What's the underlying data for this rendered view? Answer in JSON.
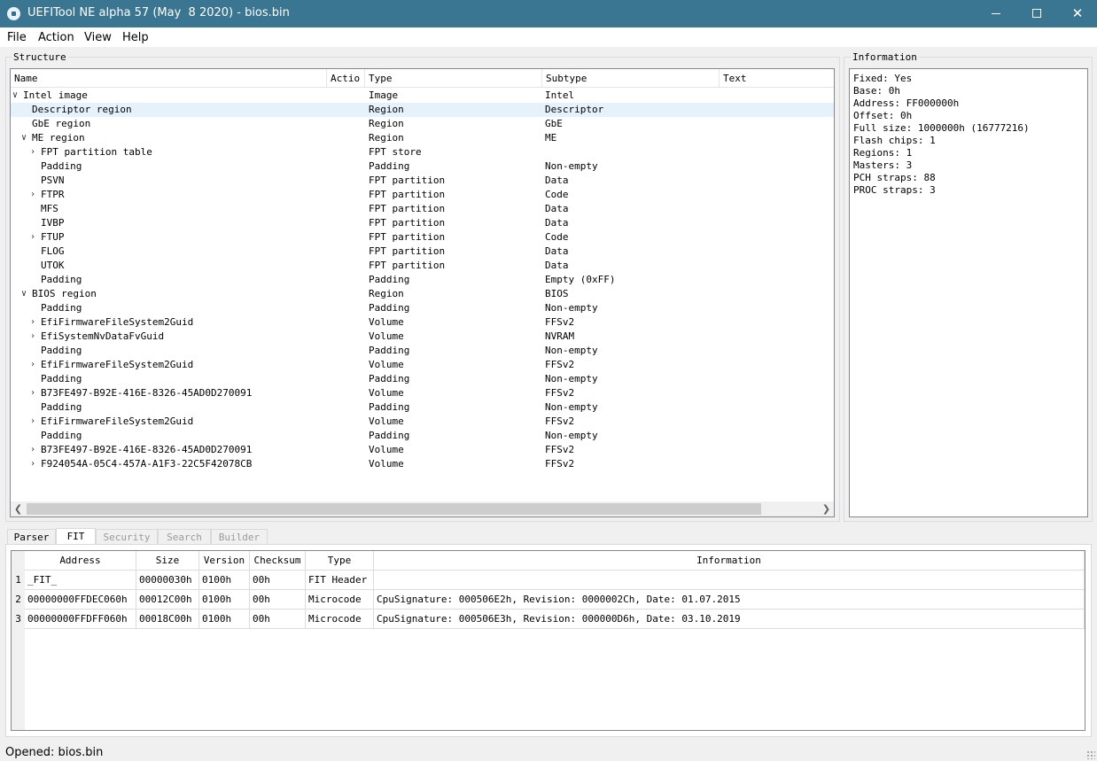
{
  "window": {
    "title": "UEFITool NE alpha 57 (May  8 2020) - bios.bin"
  },
  "menu": [
    "File",
    "Action",
    "View",
    "Help"
  ],
  "structure": {
    "group_title": "Structure",
    "columns": [
      "Name",
      "Actio",
      "Type",
      "Subtype",
      "Text"
    ],
    "rows": [
      {
        "name": "Intel image",
        "type": "Image",
        "subtype": "Intel",
        "level": 0,
        "arrow": "expanded"
      },
      {
        "name": "Descriptor region",
        "type": "Region",
        "subtype": "Descriptor",
        "level": 1,
        "arrow": "none",
        "selected": true
      },
      {
        "name": "GbE region",
        "type": "Region",
        "subtype": "GbE",
        "level": 1,
        "arrow": "none"
      },
      {
        "name": "ME region",
        "type": "Region",
        "subtype": "ME",
        "level": 1,
        "arrow": "expanded"
      },
      {
        "name": "FPT partition table",
        "type": "FPT store",
        "subtype": "",
        "level": 2,
        "arrow": "collapsed"
      },
      {
        "name": "Padding",
        "type": "Padding",
        "subtype": "Non-empty",
        "level": 2,
        "arrow": "none"
      },
      {
        "name": "PSVN",
        "type": "FPT partition",
        "subtype": "Data",
        "level": 2,
        "arrow": "none"
      },
      {
        "name": "FTPR",
        "type": "FPT partition",
        "subtype": "Code",
        "level": 2,
        "arrow": "collapsed"
      },
      {
        "name": "MFS",
        "type": "FPT partition",
        "subtype": "Data",
        "level": 2,
        "arrow": "none"
      },
      {
        "name": "IVBP",
        "type": "FPT partition",
        "subtype": "Data",
        "level": 2,
        "arrow": "none"
      },
      {
        "name": "FTUP",
        "type": "FPT partition",
        "subtype": "Code",
        "level": 2,
        "arrow": "collapsed"
      },
      {
        "name": "FLOG",
        "type": "FPT partition",
        "subtype": "Data",
        "level": 2,
        "arrow": "none"
      },
      {
        "name": "UTOK",
        "type": "FPT partition",
        "subtype": "Data",
        "level": 2,
        "arrow": "none"
      },
      {
        "name": "Padding",
        "type": "Padding",
        "subtype": "Empty (0xFF)",
        "level": 2,
        "arrow": "none"
      },
      {
        "name": "BIOS region",
        "type": "Region",
        "subtype": "BIOS",
        "level": 1,
        "arrow": "expanded"
      },
      {
        "name": "Padding",
        "type": "Padding",
        "subtype": "Non-empty",
        "level": 2,
        "arrow": "none"
      },
      {
        "name": "EfiFirmwareFileSystem2Guid",
        "type": "Volume",
        "subtype": "FFSv2",
        "level": 2,
        "arrow": "collapsed"
      },
      {
        "name": "EfiSystemNvDataFvGuid",
        "type": "Volume",
        "subtype": "NVRAM",
        "level": 2,
        "arrow": "collapsed"
      },
      {
        "name": "Padding",
        "type": "Padding",
        "subtype": "Non-empty",
        "level": 2,
        "arrow": "none"
      },
      {
        "name": "EfiFirmwareFileSystem2Guid",
        "type": "Volume",
        "subtype": "FFSv2",
        "level": 2,
        "arrow": "collapsed"
      },
      {
        "name": "Padding",
        "type": "Padding",
        "subtype": "Non-empty",
        "level": 2,
        "arrow": "none"
      },
      {
        "name": "B73FE497-B92E-416E-8326-45AD0D270091",
        "type": "Volume",
        "subtype": "FFSv2",
        "level": 2,
        "arrow": "collapsed"
      },
      {
        "name": "Padding",
        "type": "Padding",
        "subtype": "Non-empty",
        "level": 2,
        "arrow": "none"
      },
      {
        "name": "EfiFirmwareFileSystem2Guid",
        "type": "Volume",
        "subtype": "FFSv2",
        "level": 2,
        "arrow": "collapsed"
      },
      {
        "name": "Padding",
        "type": "Padding",
        "subtype": "Non-empty",
        "level": 2,
        "arrow": "none"
      },
      {
        "name": "B73FE497-B92E-416E-8326-45AD0D270091",
        "type": "Volume",
        "subtype": "FFSv2",
        "level": 2,
        "arrow": "collapsed"
      },
      {
        "name": "F924054A-05C4-457A-A1F3-22C5F42078CB",
        "type": "Volume",
        "subtype": "FFSv2",
        "level": 2,
        "arrow": "collapsed"
      }
    ]
  },
  "information": {
    "group_title": "Information",
    "lines": [
      "Fixed: Yes",
      "Base: 0h",
      "Address: FF000000h",
      "Offset: 0h",
      "Full size: 1000000h (16777216)",
      "Flash chips: 1",
      "Regions: 1",
      "Masters: 3",
      "PCH straps: 88",
      "PROC straps: 3"
    ]
  },
  "tabs": [
    {
      "label": "Parser",
      "state": "normal"
    },
    {
      "label": "FIT",
      "state": "active"
    },
    {
      "label": "Security",
      "state": "disabled"
    },
    {
      "label": "Search",
      "state": "disabled"
    },
    {
      "label": "Builder",
      "state": "disabled"
    }
  ],
  "fit": {
    "columns": [
      "Address",
      "Size",
      "Version",
      "Checksum",
      "Type",
      "Information"
    ],
    "rows": [
      {
        "num": "1",
        "address": "_FIT_",
        "size": "00000030h",
        "version": "0100h",
        "checksum": "00h",
        "type": "FIT Header",
        "info": ""
      },
      {
        "num": "2",
        "address": "00000000FFDEC060h",
        "size": "00012C00h",
        "version": "0100h",
        "checksum": "00h",
        "type": "Microcode",
        "info": "CpuSignature: 000506E2h, Revision: 0000002Ch, Date: 01.07.2015"
      },
      {
        "num": "3",
        "address": "00000000FFDFF060h",
        "size": "00018C00h",
        "version": "0100h",
        "checksum": "00h",
        "type": "Microcode",
        "info": "CpuSignature: 000506E3h, Revision: 000000D6h, Date: 03.10.2019"
      }
    ]
  },
  "status": {
    "text": "Opened: bios.bin"
  },
  "colors": {
    "titlebar": "#3a7591",
    "selection": "#e5f1fb"
  },
  "icons": [
    "app-icon",
    "minimize-icon",
    "maximize-icon",
    "close-icon",
    "expand-arrow-icon",
    "collapse-arrow-icon",
    "scroll-left-icon",
    "scroll-right-icon",
    "size-grip-icon"
  ]
}
